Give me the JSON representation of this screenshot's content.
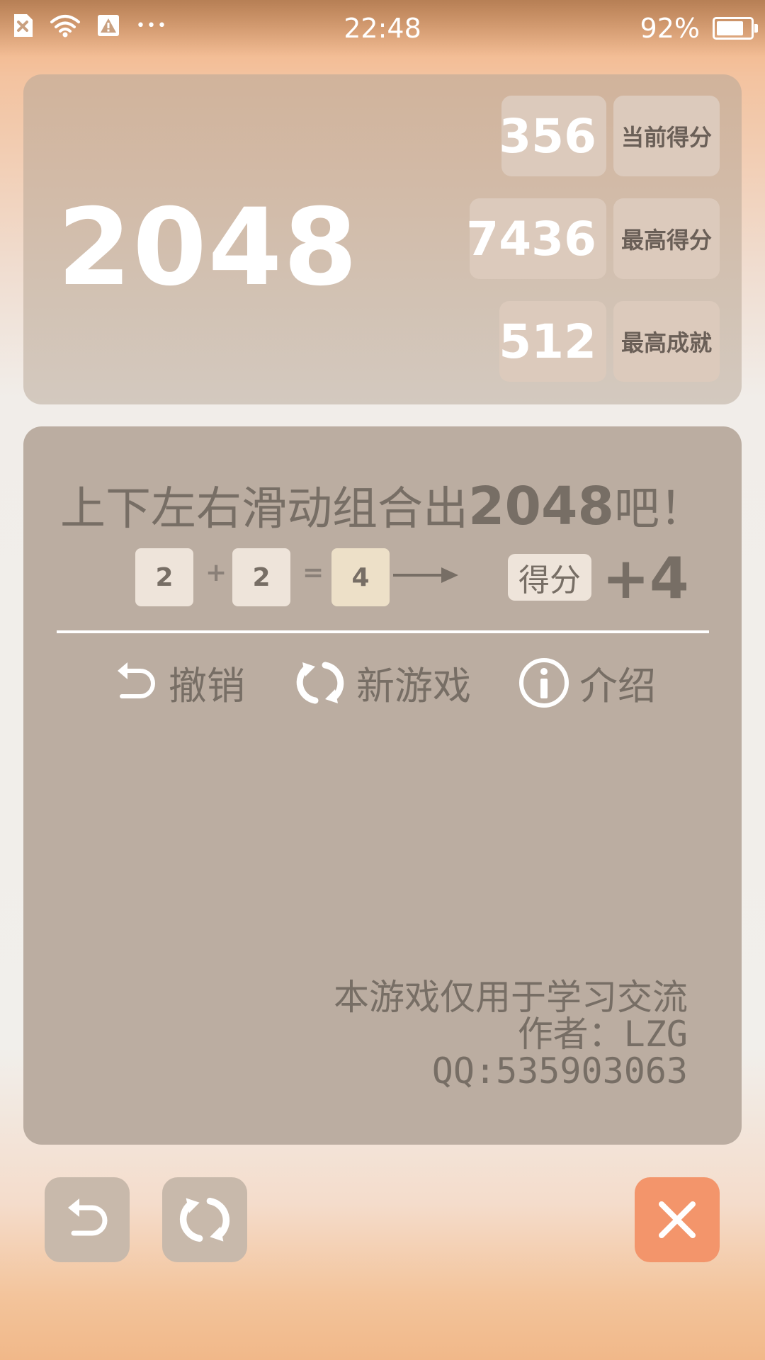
{
  "status_bar": {
    "time": "22:48",
    "battery_percent": "92%",
    "battery_level": 0.92,
    "icons": [
      "notification-x-icon",
      "wifi-icon",
      "warning-icon",
      "more-dots-icon"
    ],
    "more_glyph": "•••"
  },
  "header": {
    "logo": "2048",
    "scores": [
      {
        "value": "356",
        "label": "当前得分"
      },
      {
        "value": "7436",
        "label": "最高得分"
      },
      {
        "value": "512",
        "label": "最高成就"
      }
    ]
  },
  "main": {
    "tagline_prefix": "上下左右滑动组合出",
    "tagline_number": "2048",
    "tagline_suffix": "吧！",
    "formula": {
      "tile_a": "2",
      "op_plus": "+",
      "tile_b": "2",
      "op_equals": "=",
      "tile_result": "4",
      "badge": "得分",
      "score_gain": "+4"
    },
    "menu": [
      {
        "label": "撤销",
        "icon": "undo-icon"
      },
      {
        "label": "新游戏",
        "icon": "refresh-icon"
      },
      {
        "label": "介绍",
        "icon": "info-icon"
      }
    ],
    "credits": [
      "本游戏仅用于学习交流",
      "作者：LZG",
      "QQ:535903063"
    ]
  },
  "bottom_buttons": [
    {
      "icon": "undo-icon"
    },
    {
      "icon": "refresh-icon"
    },
    {
      "icon": "close-icon"
    }
  ],
  "colors": {
    "text_dark": "#776e65",
    "board_bg": "#bbada1",
    "tile_2": "#eee4da",
    "tile_4": "#ede0c8",
    "close_button": "#f3956b"
  }
}
